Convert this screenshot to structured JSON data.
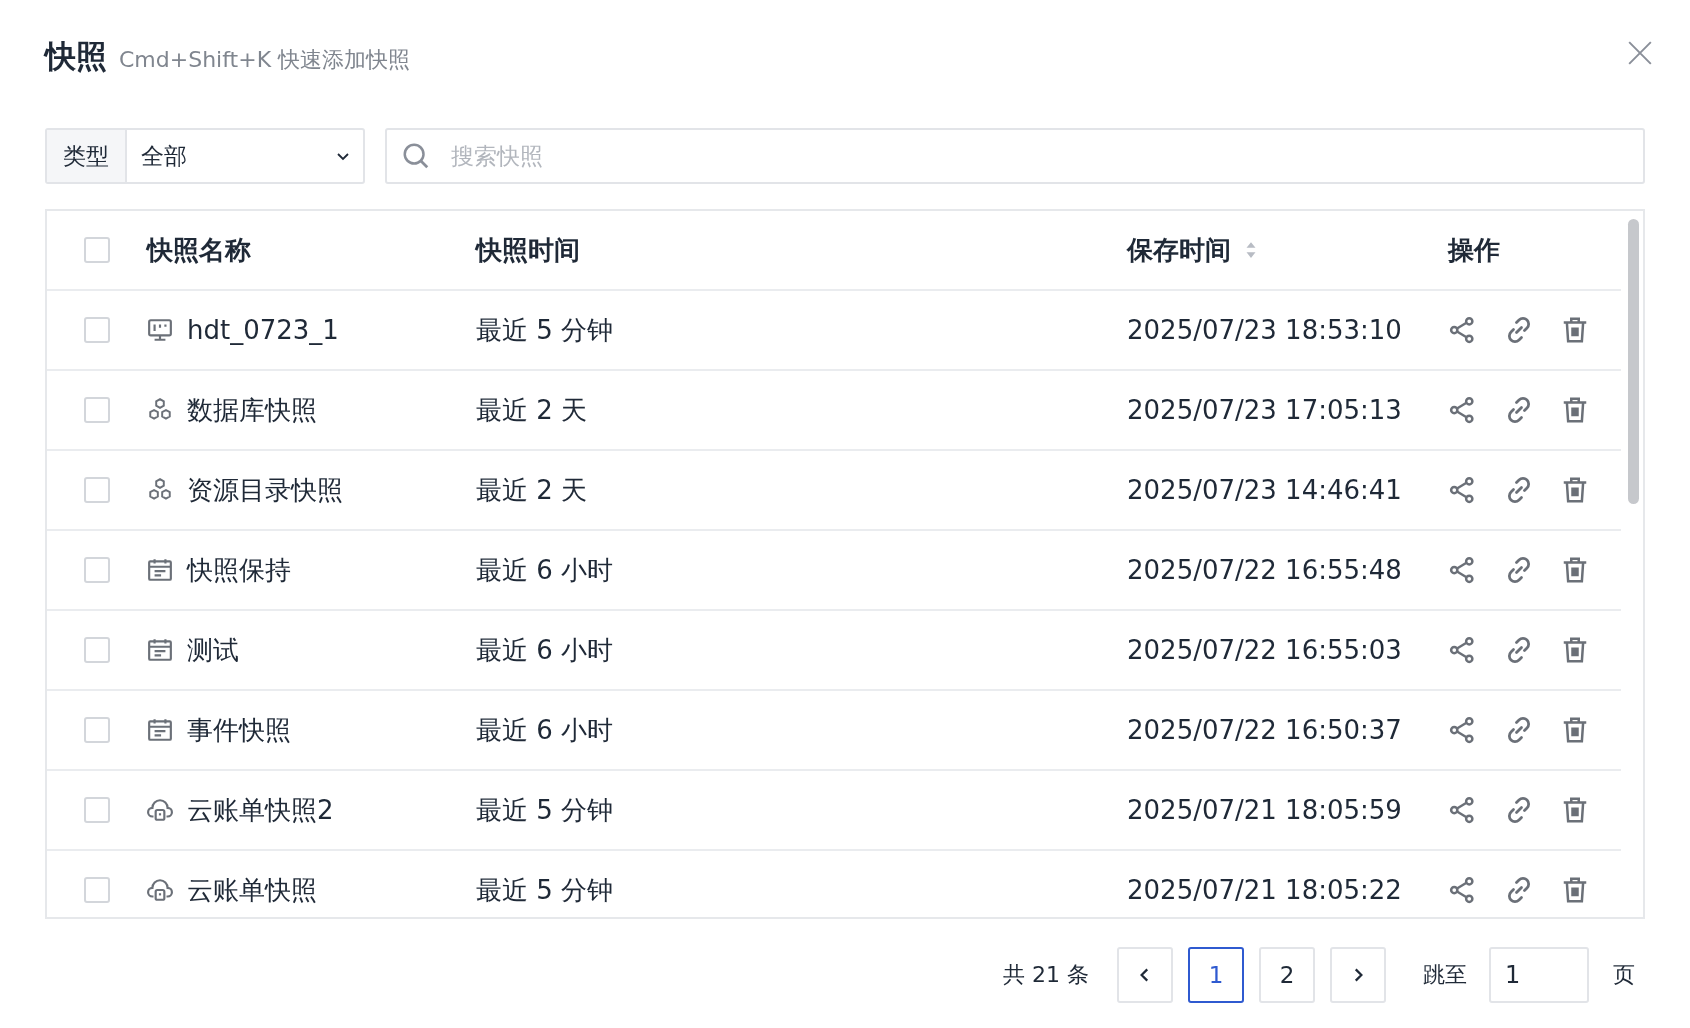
{
  "dialog": {
    "title": "快照",
    "subtitle": "Cmd+Shift+K 快速添加快照"
  },
  "filter": {
    "label": "类型",
    "value": "全部"
  },
  "search": {
    "placeholder": "搜索快照"
  },
  "table": {
    "select_all_checked": false,
    "columns": [
      "快照名称",
      "快照时间",
      "保存时间",
      "操作"
    ],
    "rows": [
      {
        "checked": false,
        "kind": "monitor",
        "name": "hdt_0723_1",
        "range": "最近 5 分钟",
        "saved": "2025/07/23 18:53:10"
      },
      {
        "checked": false,
        "kind": "cluster",
        "name": "数据库快照",
        "range": "最近 2 天",
        "saved": "2025/07/23 17:05:13"
      },
      {
        "checked": false,
        "kind": "cluster",
        "name": "资源目录快照",
        "range": "最近 2 天",
        "saved": "2025/07/23 14:46:41"
      },
      {
        "checked": false,
        "kind": "calendar",
        "name": "快照保持",
        "range": "最近 6 小时",
        "saved": "2025/07/22 16:55:48"
      },
      {
        "checked": false,
        "kind": "calendar",
        "name": "测试",
        "range": "最近 6 小时",
        "saved": "2025/07/22 16:55:03"
      },
      {
        "checked": false,
        "kind": "calendar",
        "name": "事件快照",
        "range": "最近 6 小时",
        "saved": "2025/07/22 16:50:37"
      },
      {
        "checked": false,
        "kind": "cloud",
        "name": "云账单快照2",
        "range": "最近 5 分钟",
        "saved": "2025/07/21 18:05:59"
      },
      {
        "checked": false,
        "kind": "cloud",
        "name": "云账单快照",
        "range": "最近 5 分钟",
        "saved": "2025/07/21 18:05:22"
      }
    ]
  },
  "pagination": {
    "total": "共 21 条",
    "pages": [
      {
        "label": "1",
        "selected": true
      },
      {
        "label": "2",
        "selected": false
      }
    ],
    "jump_label": "跳至",
    "jump_value": "1",
    "page_unit": "页"
  }
}
